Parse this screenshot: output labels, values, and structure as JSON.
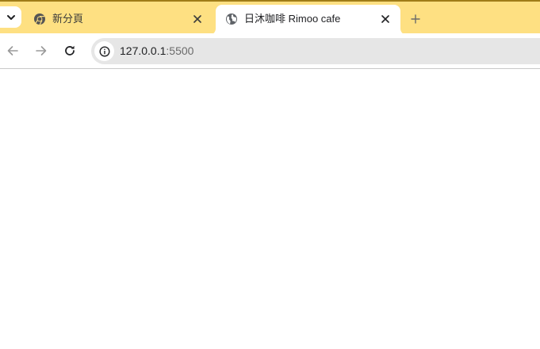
{
  "colors": {
    "tabstrip_bg": "#fee082",
    "active_tab_bg": "#ffffff",
    "omnibox_bg": "#e6e6e6",
    "page_bg": "#ffffff"
  },
  "tabs": [
    {
      "title": "新分頁",
      "icon": "chrome-logo-icon",
      "active": false
    },
    {
      "title": "日沐咖啡 Rimoo cafe",
      "icon": "globe-icon",
      "active": true
    }
  ],
  "toolbar": {
    "url_host": "127.0.0.1",
    "url_port": ":5500",
    "back_icon": "arrow-left-icon",
    "forward_icon": "arrow-right-icon",
    "reload_icon": "reload-icon",
    "site_info_icon": "info-icon"
  }
}
